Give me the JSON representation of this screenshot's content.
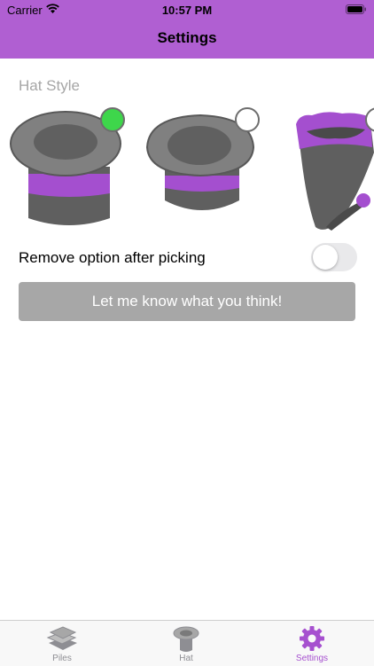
{
  "status_bar": {
    "carrier": "Carrier",
    "time": "10:57 PM"
  },
  "nav": {
    "title": "Settings"
  },
  "settings": {
    "hat_style_label": "Hat Style",
    "hat_options": [
      {
        "name": "top-hat",
        "selected": true
      },
      {
        "name": "bowler-hat",
        "selected": false
      },
      {
        "name": "wizard-hat",
        "selected": false
      }
    ],
    "remove_option_label": "Remove option after picking",
    "remove_option_enabled": false,
    "feedback_button_label": "Let me know what you think!"
  },
  "tabbar": {
    "tabs": [
      {
        "label": "Piles",
        "icon": "piles-icon",
        "active": false
      },
      {
        "label": "Hat",
        "icon": "hat-icon",
        "active": false
      },
      {
        "label": "Settings",
        "icon": "gear-icon",
        "active": true
      }
    ]
  },
  "colors": {
    "accent": "#b05fd2",
    "selected_dot": "#3ed64b",
    "button_gray": "#a7a7a7",
    "tab_active": "#a650cf"
  }
}
